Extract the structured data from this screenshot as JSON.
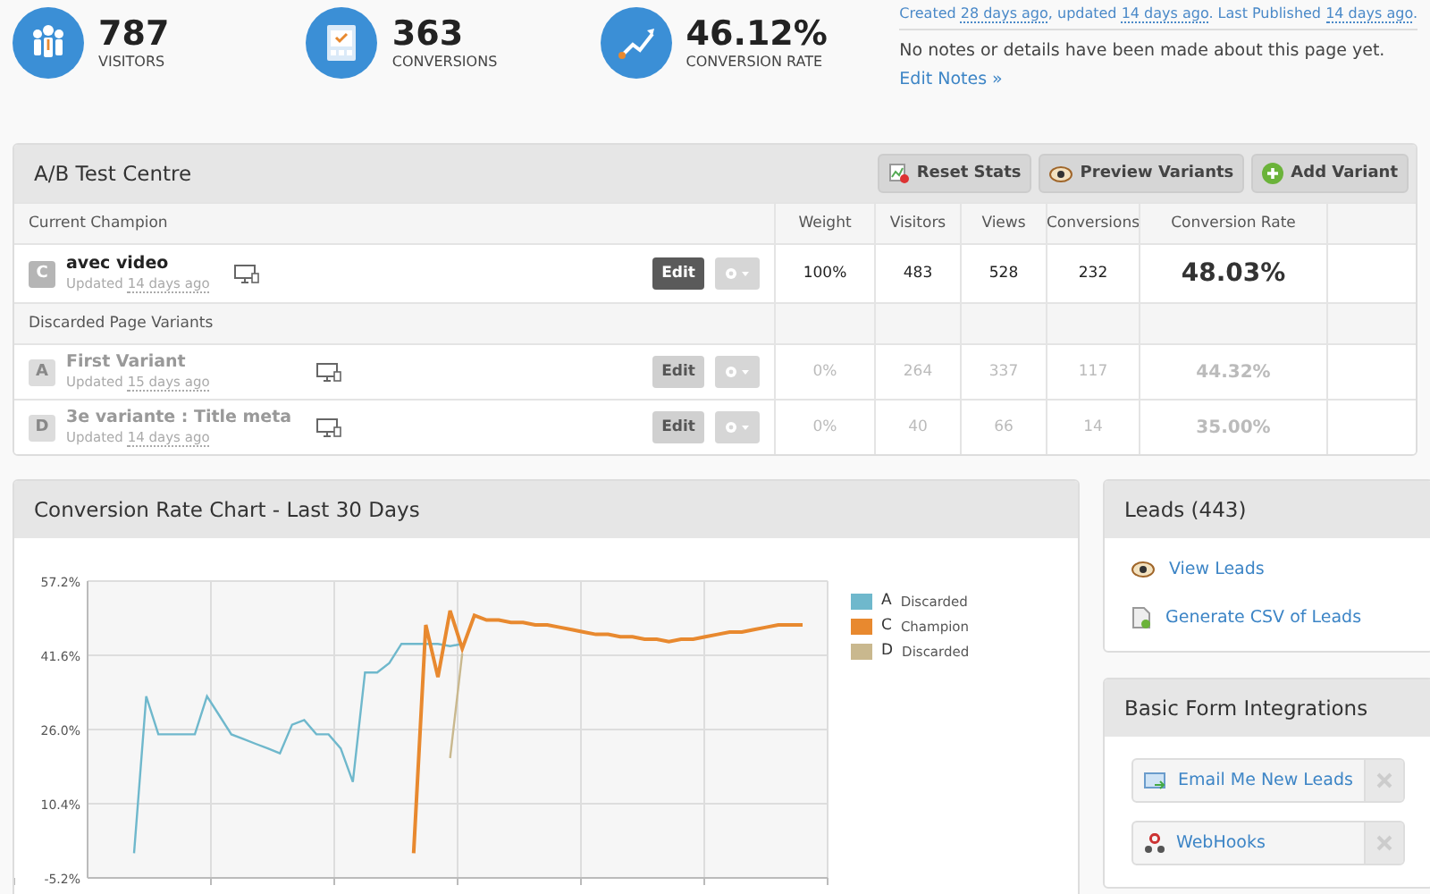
{
  "stats": [
    {
      "kind": "visitors",
      "value": "787",
      "label": "VISITORS"
    },
    {
      "kind": "conversions",
      "value": "363",
      "label": "CONVERSIONS"
    },
    {
      "kind": "rate",
      "value": "46.12%",
      "label": "CONVERSION RATE"
    }
  ],
  "meta": {
    "parts": [
      {
        "kind": "plain",
        "text": "Created "
      },
      {
        "kind": "date",
        "text": "28 days ago"
      },
      {
        "kind": "plain",
        "text": ", updated "
      },
      {
        "kind": "date",
        "text": "14 days ago"
      },
      {
        "kind": "plain",
        "text": ". Last Published "
      },
      {
        "kind": "date",
        "text": "14 days ago"
      },
      {
        "kind": "plain",
        "text": "."
      }
    ],
    "notes": "No notes or details have been made about this page yet.",
    "edit_link": "Edit Notes »"
  },
  "ab_test": {
    "title": "A/B Test Centre",
    "buttons": [
      {
        "kind": "reset",
        "label": "Reset Stats"
      },
      {
        "kind": "preview",
        "label": "Preview Variants"
      },
      {
        "kind": "add",
        "label": "Add Variant"
      }
    ],
    "columns": [
      "Current Champion",
      "Weight",
      "Visitors",
      "Views",
      "Conversions",
      "Conversion Rate"
    ],
    "champion": {
      "letter": "C",
      "name": "avec video",
      "updated_label": "Updated",
      "updated": "14 days ago",
      "edit": "Edit",
      "weight": "100%",
      "visitors": "483",
      "views": "528",
      "conversions": "232",
      "rate": "48.03%",
      "discarded": false
    },
    "discarded_label": "Discarded Page Variants",
    "variants": [
      {
        "letter": "A",
        "name": "First Variant",
        "updated_label": "Updated",
        "updated": "15 days ago",
        "edit": "Edit",
        "weight": "0%",
        "visitors": "264",
        "views": "337",
        "conversions": "117",
        "rate": "44.32%",
        "discarded": true
      },
      {
        "letter": "D",
        "name": "3e variante : Title meta",
        "updated_label": "Updated",
        "updated": "14 days ago",
        "edit": "Edit",
        "weight": "0%",
        "visitors": "40",
        "views": "66",
        "conversions": "14",
        "rate": "35.00%",
        "discarded": true
      }
    ]
  },
  "chart": {
    "title": "Conversion Rate Chart - Last 30 Days",
    "legend": [
      {
        "status": "Discarded"
      },
      {
        "status": "Champion"
      },
      {
        "status": "Discarded"
      }
    ],
    "chart_data": {
      "type": "line",
      "categories": [
        null,
        null,
        null,
        null,
        null,
        null,
        null,
        null,
        null,
        null,
        null,
        null,
        null,
        null,
        null,
        null,
        null,
        null,
        null,
        null,
        null,
        null,
        null,
        null,
        null,
        null,
        null,
        null,
        null,
        null,
        null,
        null,
        null,
        null,
        null,
        null,
        null,
        null,
        null,
        null,
        null,
        null,
        null,
        null,
        null,
        null,
        null,
        null,
        null,
        null,
        null,
        null,
        null,
        null,
        null,
        null
      ],
      "ylim": [
        -5.2,
        57.2
      ],
      "grid": true,
      "yticks": [
        {
          "value": -5.2,
          "label": "-5.2%"
        },
        {
          "value": 10.4,
          "label": "10.4%"
        },
        {
          "value": 26,
          "label": "26.0%"
        },
        {
          "value": 41.6,
          "label": "41.6%"
        },
        {
          "value": 57.2,
          "label": "57.2%"
        }
      ],
      "series": [
        {
          "name": "A",
          "color": "#6fb8cc",
          "values": [
            0,
            33,
            25,
            25,
            25,
            25,
            33,
            29,
            25,
            24,
            23,
            22,
            21,
            27,
            28,
            25,
            25,
            22,
            15,
            38,
            38,
            40,
            44,
            44,
            44,
            44,
            43.5,
            44,
            null,
            null,
            null,
            null,
            null,
            null,
            null,
            null,
            null,
            null,
            null,
            null,
            null,
            null,
            null,
            null,
            null,
            null,
            null,
            null,
            null,
            null,
            null,
            null,
            null,
            null,
            null,
            null
          ]
        },
        {
          "name": "C",
          "color": "#e8892f",
          "values": [
            null,
            null,
            null,
            null,
            null,
            null,
            null,
            null,
            null,
            null,
            null,
            null,
            null,
            null,
            null,
            null,
            null,
            null,
            null,
            null,
            null,
            null,
            null,
            0,
            48,
            37,
            51,
            43,
            50,
            49,
            49,
            48.5,
            48.5,
            48,
            48,
            47.5,
            47,
            46.5,
            46,
            46,
            45.5,
            45.5,
            45,
            45,
            44.5,
            45,
            45,
            45.5,
            46,
            46.5,
            46.5,
            47,
            47.5,
            48,
            48,
            48
          ]
        },
        {
          "name": "D",
          "color": "#c9b88e",
          "values": [
            null,
            null,
            null,
            null,
            null,
            null,
            null,
            null,
            null,
            null,
            null,
            null,
            null,
            null,
            null,
            null,
            null,
            null,
            null,
            null,
            null,
            null,
            null,
            null,
            null,
            null,
            20,
            42,
            null,
            null,
            null,
            null,
            null,
            null,
            null,
            null,
            null,
            null,
            null,
            null,
            null,
            null,
            null,
            null,
            null,
            null,
            null,
            null,
            null,
            null,
            null,
            null,
            null,
            null,
            null,
            null
          ]
        }
      ]
    }
  },
  "leads": {
    "title": "Leads (443)",
    "links": [
      {
        "kind": "view",
        "label": "View Leads"
      },
      {
        "kind": "csv",
        "label": "Generate CSV of Leads"
      }
    ]
  },
  "integrations": {
    "title": "Basic Form Integrations",
    "items": [
      {
        "kind": "email",
        "label": "Email Me New Leads"
      },
      {
        "kind": "webhook",
        "label": "WebHooks"
      }
    ]
  }
}
